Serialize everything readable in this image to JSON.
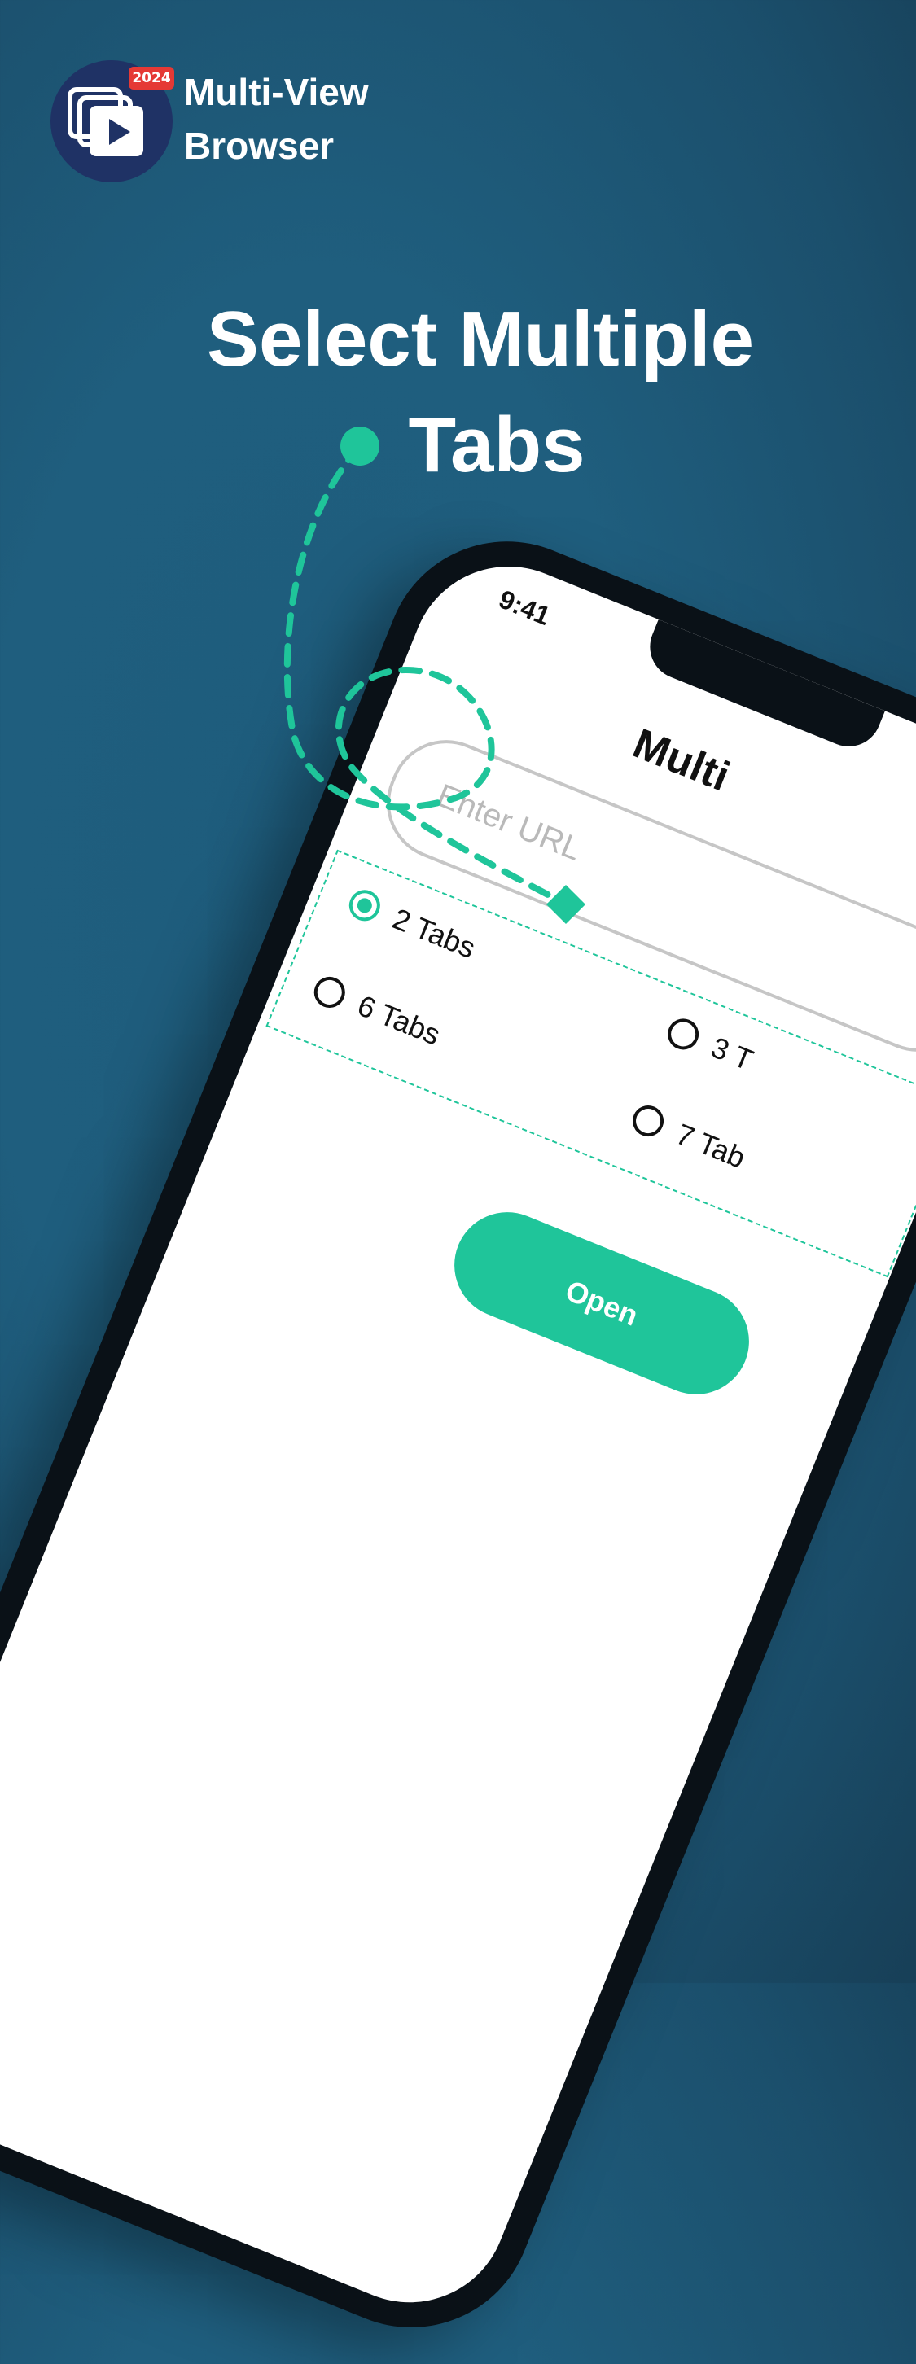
{
  "app": {
    "badge": "2024",
    "name_line1": "Multi-View",
    "name_line2": "Browser",
    "logo_icon": "play-stack-icon"
  },
  "headline": {
    "line1": "Select Multiple",
    "line2": "Tabs"
  },
  "phone": {
    "status_time": "9:41",
    "title": "Multi",
    "url_placeholder": "Enter URL",
    "options": [
      {
        "label": "2 Tabs",
        "selected": true
      },
      {
        "label": "3 T",
        "selected": false
      },
      {
        "label": "6 Tabs",
        "selected": false
      },
      {
        "label": "7 Tab",
        "selected": false
      }
    ],
    "open_button": "Open"
  },
  "colors": {
    "background": "#1f5e7e",
    "accent": "#1fc59a",
    "logo_bg": "#1f3265",
    "badge": "#e53935"
  }
}
